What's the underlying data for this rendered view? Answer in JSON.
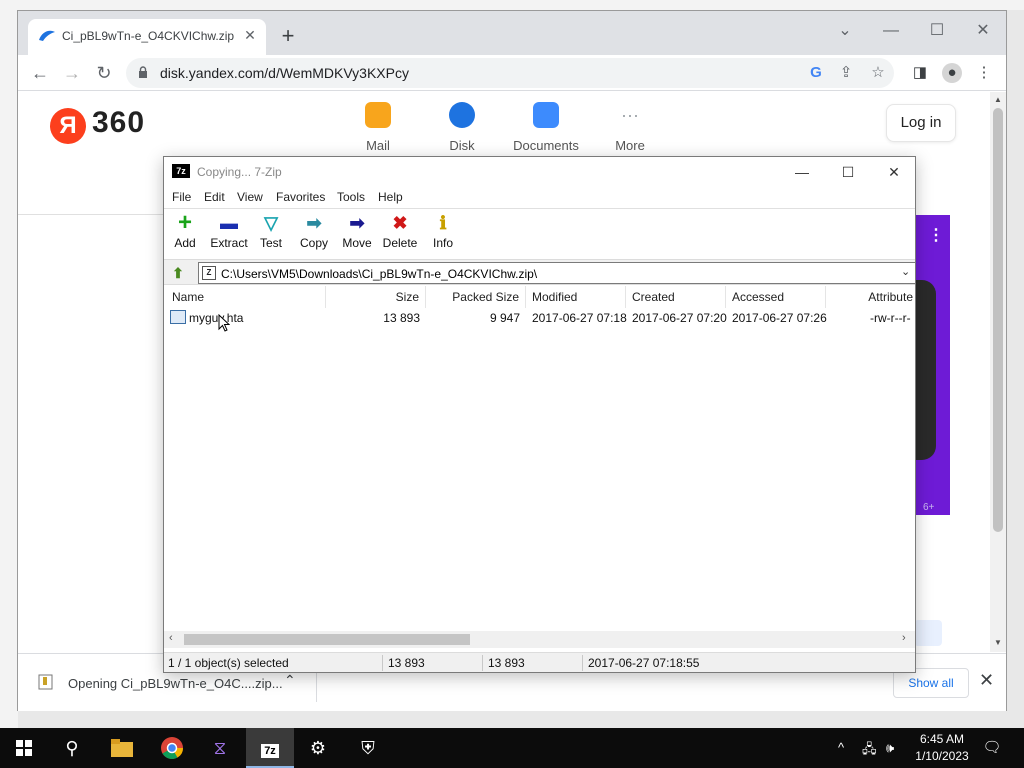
{
  "browser": {
    "tab_title": "Ci_pBL9wTn-e_O4CKVIChw.zip —",
    "url": "disk.yandex.com/d/WemMDKVy3KXPcy",
    "new_tab": "+",
    "close": "✕"
  },
  "site": {
    "brand": "360",
    "logo_letter": "Я",
    "services": [
      {
        "label": "Mail",
        "color": "#f8a51c"
      },
      {
        "label": "Disk",
        "color": "#1e73e0"
      },
      {
        "label": "Documents",
        "color": "#3d8bfd"
      },
      {
        "label": "More",
        "color": "#9aa0a6"
      }
    ],
    "login": "Log in",
    "more_dots": "···",
    "ad_menu": "⋮",
    "ad_age": "6+"
  },
  "zip": {
    "title": "Copying... 7-Zip",
    "icon_label": "7z",
    "menu": [
      "File",
      "Edit",
      "View",
      "Favorites",
      "Tools",
      "Help"
    ],
    "toolbar": [
      {
        "label": "Add",
        "icon": "+",
        "color": "#1aa41a"
      },
      {
        "label": "Extract",
        "icon": "▬",
        "color": "#1a2fb0"
      },
      {
        "label": "Test",
        "icon": "▽",
        "color": "#1aa4b0"
      },
      {
        "label": "Copy",
        "icon": "➡",
        "color": "#2a8aa0"
      },
      {
        "label": "Move",
        "icon": "➡",
        "color": "#1a1a90"
      },
      {
        "label": "Delete",
        "icon": "✖",
        "color": "#d01818"
      },
      {
        "label": "Info",
        "icon": "ℹ",
        "color": "#c8a000"
      }
    ],
    "path": "C:\\Users\\VM5\\Downloads\\Ci_pBL9wTn-e_O4CKVIChw.zip\\",
    "columns": [
      "Name",
      "Size",
      "Packed Size",
      "Modified",
      "Created",
      "Accessed",
      "Attribute"
    ],
    "rows": [
      {
        "name": "myguy.hta",
        "size": "13 893",
        "packed": "9 947",
        "modified": "2017-06-27 07:18",
        "created": "2017-06-27 07:20",
        "accessed": "2017-06-27 07:26",
        "attr": "-rw-r--r-"
      }
    ],
    "status": {
      "selected": "1 / 1 object(s) selected",
      "size": "13 893",
      "packed": "13 893",
      "modified": "2017-06-27 07:18:55"
    }
  },
  "download": {
    "text": "Opening Ci_pBL9wTn-e_O4C....zip...",
    "show_all": "Show all"
  },
  "taskbar": {
    "time": "6:45 AM",
    "date": "1/10/2023",
    "apps": [
      "file-explorer",
      "chrome",
      "visual-studio",
      "7zip",
      "settings",
      "security"
    ]
  }
}
